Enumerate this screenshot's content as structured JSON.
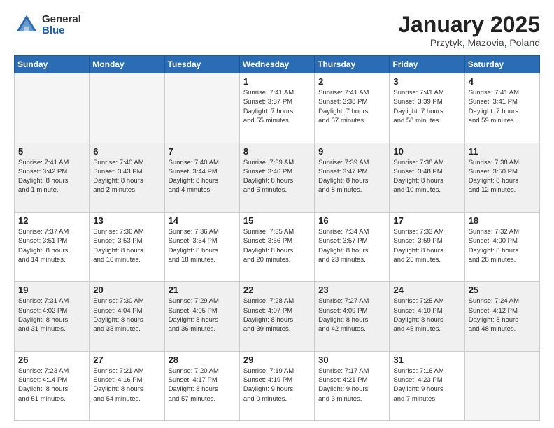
{
  "logo": {
    "general": "General",
    "blue": "Blue"
  },
  "header": {
    "title": "January 2025",
    "subtitle": "Przytyk, Mazovia, Poland"
  },
  "days_of_week": [
    "Sunday",
    "Monday",
    "Tuesday",
    "Wednesday",
    "Thursday",
    "Friday",
    "Saturday"
  ],
  "weeks": [
    {
      "shaded": false,
      "days": [
        {
          "num": "",
          "info": "",
          "empty": true
        },
        {
          "num": "",
          "info": "",
          "empty": true
        },
        {
          "num": "",
          "info": "",
          "empty": true
        },
        {
          "num": "1",
          "info": "Sunrise: 7:41 AM\nSunset: 3:37 PM\nDaylight: 7 hours\nand 55 minutes.",
          "empty": false
        },
        {
          "num": "2",
          "info": "Sunrise: 7:41 AM\nSunset: 3:38 PM\nDaylight: 7 hours\nand 57 minutes.",
          "empty": false
        },
        {
          "num": "3",
          "info": "Sunrise: 7:41 AM\nSunset: 3:39 PM\nDaylight: 7 hours\nand 58 minutes.",
          "empty": false
        },
        {
          "num": "4",
          "info": "Sunrise: 7:41 AM\nSunset: 3:41 PM\nDaylight: 7 hours\nand 59 minutes.",
          "empty": false
        }
      ]
    },
    {
      "shaded": true,
      "days": [
        {
          "num": "5",
          "info": "Sunrise: 7:41 AM\nSunset: 3:42 PM\nDaylight: 8 hours\nand 1 minute.",
          "empty": false
        },
        {
          "num": "6",
          "info": "Sunrise: 7:40 AM\nSunset: 3:43 PM\nDaylight: 8 hours\nand 2 minutes.",
          "empty": false
        },
        {
          "num": "7",
          "info": "Sunrise: 7:40 AM\nSunset: 3:44 PM\nDaylight: 8 hours\nand 4 minutes.",
          "empty": false
        },
        {
          "num": "8",
          "info": "Sunrise: 7:39 AM\nSunset: 3:46 PM\nDaylight: 8 hours\nand 6 minutes.",
          "empty": false
        },
        {
          "num": "9",
          "info": "Sunrise: 7:39 AM\nSunset: 3:47 PM\nDaylight: 8 hours\nand 8 minutes.",
          "empty": false
        },
        {
          "num": "10",
          "info": "Sunrise: 7:38 AM\nSunset: 3:48 PM\nDaylight: 8 hours\nand 10 minutes.",
          "empty": false
        },
        {
          "num": "11",
          "info": "Sunrise: 7:38 AM\nSunset: 3:50 PM\nDaylight: 8 hours\nand 12 minutes.",
          "empty": false
        }
      ]
    },
    {
      "shaded": false,
      "days": [
        {
          "num": "12",
          "info": "Sunrise: 7:37 AM\nSunset: 3:51 PM\nDaylight: 8 hours\nand 14 minutes.",
          "empty": false
        },
        {
          "num": "13",
          "info": "Sunrise: 7:36 AM\nSunset: 3:53 PM\nDaylight: 8 hours\nand 16 minutes.",
          "empty": false
        },
        {
          "num": "14",
          "info": "Sunrise: 7:36 AM\nSunset: 3:54 PM\nDaylight: 8 hours\nand 18 minutes.",
          "empty": false
        },
        {
          "num": "15",
          "info": "Sunrise: 7:35 AM\nSunset: 3:56 PM\nDaylight: 8 hours\nand 20 minutes.",
          "empty": false
        },
        {
          "num": "16",
          "info": "Sunrise: 7:34 AM\nSunset: 3:57 PM\nDaylight: 8 hours\nand 23 minutes.",
          "empty": false
        },
        {
          "num": "17",
          "info": "Sunrise: 7:33 AM\nSunset: 3:59 PM\nDaylight: 8 hours\nand 25 minutes.",
          "empty": false
        },
        {
          "num": "18",
          "info": "Sunrise: 7:32 AM\nSunset: 4:00 PM\nDaylight: 8 hours\nand 28 minutes.",
          "empty": false
        }
      ]
    },
    {
      "shaded": true,
      "days": [
        {
          "num": "19",
          "info": "Sunrise: 7:31 AM\nSunset: 4:02 PM\nDaylight: 8 hours\nand 31 minutes.",
          "empty": false
        },
        {
          "num": "20",
          "info": "Sunrise: 7:30 AM\nSunset: 4:04 PM\nDaylight: 8 hours\nand 33 minutes.",
          "empty": false
        },
        {
          "num": "21",
          "info": "Sunrise: 7:29 AM\nSunset: 4:05 PM\nDaylight: 8 hours\nand 36 minutes.",
          "empty": false
        },
        {
          "num": "22",
          "info": "Sunrise: 7:28 AM\nSunset: 4:07 PM\nDaylight: 8 hours\nand 39 minutes.",
          "empty": false
        },
        {
          "num": "23",
          "info": "Sunrise: 7:27 AM\nSunset: 4:09 PM\nDaylight: 8 hours\nand 42 minutes.",
          "empty": false
        },
        {
          "num": "24",
          "info": "Sunrise: 7:25 AM\nSunset: 4:10 PM\nDaylight: 8 hours\nand 45 minutes.",
          "empty": false
        },
        {
          "num": "25",
          "info": "Sunrise: 7:24 AM\nSunset: 4:12 PM\nDaylight: 8 hours\nand 48 minutes.",
          "empty": false
        }
      ]
    },
    {
      "shaded": false,
      "days": [
        {
          "num": "26",
          "info": "Sunrise: 7:23 AM\nSunset: 4:14 PM\nDaylight: 8 hours\nand 51 minutes.",
          "empty": false
        },
        {
          "num": "27",
          "info": "Sunrise: 7:21 AM\nSunset: 4:16 PM\nDaylight: 8 hours\nand 54 minutes.",
          "empty": false
        },
        {
          "num": "28",
          "info": "Sunrise: 7:20 AM\nSunset: 4:17 PM\nDaylight: 8 hours\nand 57 minutes.",
          "empty": false
        },
        {
          "num": "29",
          "info": "Sunrise: 7:19 AM\nSunset: 4:19 PM\nDaylight: 9 hours\nand 0 minutes.",
          "empty": false
        },
        {
          "num": "30",
          "info": "Sunrise: 7:17 AM\nSunset: 4:21 PM\nDaylight: 9 hours\nand 3 minutes.",
          "empty": false
        },
        {
          "num": "31",
          "info": "Sunrise: 7:16 AM\nSunset: 4:23 PM\nDaylight: 9 hours\nand 7 minutes.",
          "empty": false
        },
        {
          "num": "",
          "info": "",
          "empty": true
        }
      ]
    }
  ]
}
